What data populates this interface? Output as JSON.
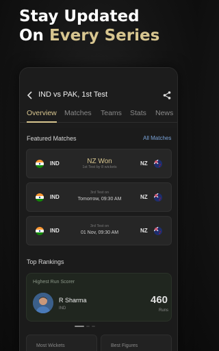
{
  "headline": {
    "line1": "Stay Updated",
    "line2_prefix": "On ",
    "line2_accent": "Every Series"
  },
  "header": {
    "title": "IND vs PAK, 1st Test"
  },
  "tabs": [
    "Overview",
    "Matches",
    "Teams",
    "Stats",
    "News"
  ],
  "featured": {
    "title": "Featured Matches",
    "all_link": "All Matches",
    "matches": [
      {
        "team_left": "IND",
        "team_right": "NZ",
        "status": "NZ Won",
        "detail": "1st Test by 8 wickets"
      },
      {
        "team_left": "IND",
        "team_right": "NZ",
        "label": "3rd Test on",
        "datetime": "Tomorrow, 09:30 AM"
      },
      {
        "team_left": "IND",
        "team_right": "NZ",
        "label": "3rd Test on",
        "datetime": "01 Nov, 09:30 AM"
      }
    ]
  },
  "rankings": {
    "title": "Top Rankings",
    "card": {
      "label": "Highest Run Scorer",
      "player": "R Sharma",
      "team": "IND",
      "value": "460",
      "unit": "Runs"
    },
    "mini_cards": [
      "Most Wickets",
      "Best Figures"
    ]
  },
  "colors": {
    "accent": "#d8c690",
    "link": "#7aa3d8",
    "background": "#1b1b1b"
  },
  "icons": {
    "back": "chevron-left-icon",
    "share": "share-icon"
  }
}
